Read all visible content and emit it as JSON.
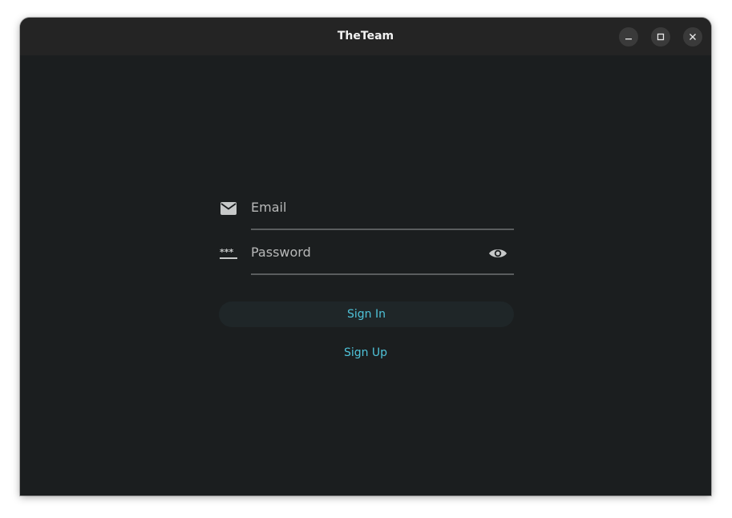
{
  "window": {
    "title": "TheTeam"
  },
  "form": {
    "email": {
      "placeholder": "Email",
      "value": "",
      "icon": "mail-icon"
    },
    "password": {
      "placeholder": "Password",
      "value": "",
      "icon": "password-icon",
      "toggle_icon": "eye-icon"
    },
    "sign_in_label": "Sign In",
    "sign_up_label": "Sign Up"
  },
  "colors": {
    "accent": "#4fc3d9",
    "background": "#1b1e1f",
    "titlebar": "#242424"
  }
}
